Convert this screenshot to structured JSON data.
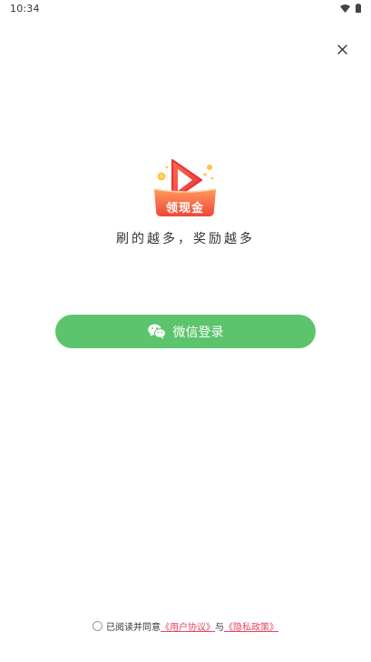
{
  "status_bar": {
    "time": "10:34",
    "icons": [
      "wifi-icon",
      "battery-icon"
    ]
  },
  "header": {
    "close_icon": "close-icon"
  },
  "logo": {
    "icon": "play-logo-icon",
    "badge_text": "领现金"
  },
  "tagline": "刷的越多，奖励越多",
  "login": {
    "icon": "wechat-icon",
    "label": "微信登录",
    "color": "#5cc46d"
  },
  "agreement": {
    "prefix": "已阅读并同意",
    "user_agreement": "《用户协议》",
    "conjunction": "与",
    "privacy_policy": "《隐私政策》",
    "link_color": "#e8455c"
  }
}
